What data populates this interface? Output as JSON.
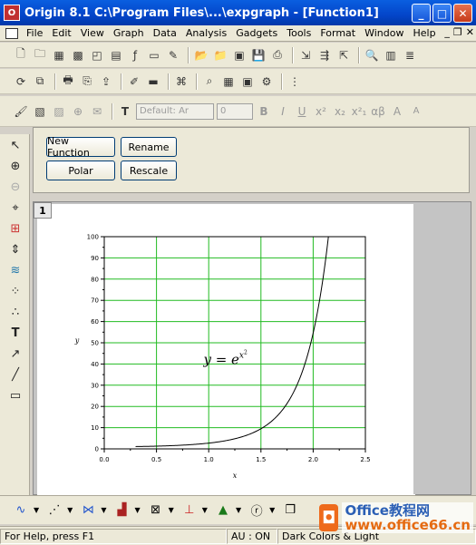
{
  "window": {
    "title": "Origin 8.1 C:\\Program Files\\...\\expgraph - [Function1]",
    "app_icon": "origin-app-icon",
    "controls": [
      "minimize",
      "maximize",
      "close"
    ]
  },
  "menubar": {
    "items": [
      "File",
      "Edit",
      "View",
      "Graph",
      "Data",
      "Analysis",
      "Gadgets",
      "Tools",
      "Format",
      "Window",
      "Help"
    ],
    "mdi_controls": [
      "minimize",
      "restore",
      "close"
    ]
  },
  "format_toolbar": {
    "font_name": "Default: Ar",
    "font_size": "0",
    "style_buttons": [
      "B",
      "I",
      "U",
      "x²",
      "x₂",
      "x²₁",
      "αβ",
      "A",
      "A"
    ]
  },
  "button_panel": {
    "new_function": "New Function",
    "rename": "Rename",
    "polar": "Polar",
    "rescale": "Rescale"
  },
  "graph": {
    "layer_label": "1",
    "equation_lhs": "y",
    "equation_eq": " = ",
    "equation_base": "e",
    "equation_exp": "x",
    "equation_exp_sup": "2"
  },
  "chart_data": {
    "type": "line",
    "function": "y = exp(x^2)",
    "x_start": 0.3,
    "x_end": 2.15,
    "xlabel": "x",
    "ylabel": "y",
    "xlim": [
      0,
      2.5
    ],
    "ylim": [
      0,
      100
    ],
    "xticks": [
      "0.0",
      "0.5",
      "1.0",
      "1.5",
      "2.0",
      "2.5"
    ],
    "yticks": [
      "0",
      "10",
      "20",
      "30",
      "40",
      "50",
      "60",
      "70",
      "80",
      "90",
      "100"
    ],
    "x_major_step": 0.5,
    "y_major_step": 10,
    "grid": true,
    "grid_color": "#22bb22",
    "line_color": "#000000",
    "show_minor_ticks": true
  },
  "statusbar": {
    "help": "For Help, press F1",
    "au": "AU : ON",
    "theme": "Dark Colors & Light"
  },
  "logo": {
    "brand_line1": "Office教程网",
    "brand_line2": "www.office66.cn"
  },
  "colors": {
    "titlebar": "#0345c9",
    "chrome": "#ece9d8",
    "grid": "#22bb22",
    "logo_orange": "#ee6a1b"
  }
}
